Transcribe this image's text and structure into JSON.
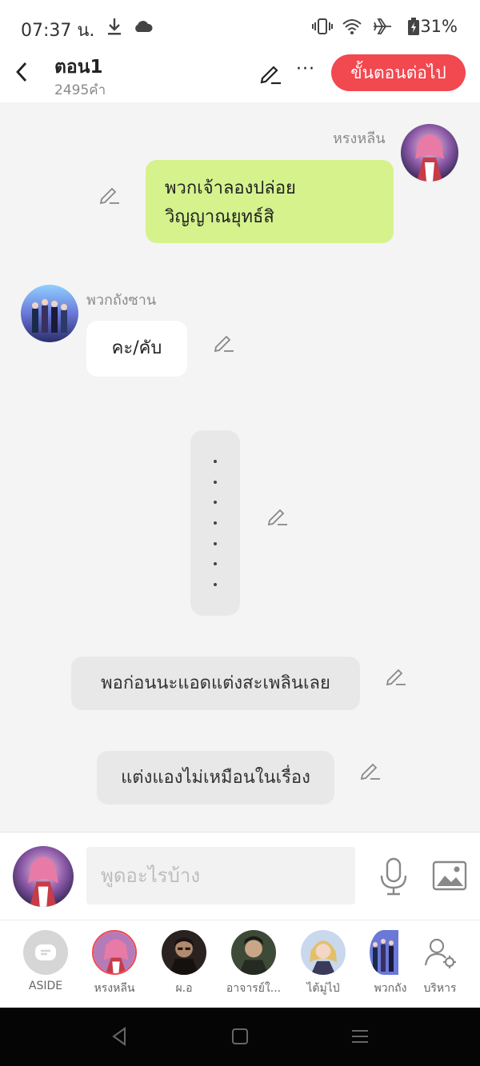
{
  "status_bar": {
    "time": "07:37 น.",
    "battery": "31%",
    "icons": [
      "download-icon",
      "cloud-icon",
      "vibrate-icon",
      "wifi-icon",
      "airplane-icon",
      "battery-icon"
    ]
  },
  "header": {
    "title": "ตอน1",
    "word_count": "2495คำ",
    "more_label": "···",
    "next_button": "ขั้นตอนต่อไป",
    "accent_color": "#f24850"
  },
  "messages": [
    {
      "speaker": "หรงหลีน",
      "text": "พวกเจ้าลองปล่อย\nวิญญาณยุทธ์สิ",
      "side": "right",
      "bubble": "green"
    },
    {
      "speaker": "พวกถังซาน",
      "text": "คะ/คับ",
      "side": "left",
      "bubble": "white"
    },
    {
      "speaker": "",
      "text": ".......",
      "side": "center",
      "bubble": "gray-vertical"
    },
    {
      "speaker": "",
      "text": "พอก่อนนะแอดแต่งสะเพลินเลย",
      "side": "center",
      "bubble": "gray"
    },
    {
      "speaker": "",
      "text": "แต่งแองไม่เหมือนในเรื่อง",
      "side": "center",
      "bubble": "gray"
    }
  ],
  "input": {
    "placeholder": "พูดอะไรบ้าง"
  },
  "characters": [
    {
      "label": "ASIDE"
    },
    {
      "label": "หรงหลีน"
    },
    {
      "label": "ผ.อ"
    },
    {
      "label": "อาจารย์ใ..."
    },
    {
      "label": "ไต้มู่ไป่"
    },
    {
      "label": "พวกถัง"
    },
    {
      "label": "บริหาร"
    }
  ],
  "colors": {
    "green_bubble": "#d5f28d",
    "chat_bg": "#f4f4f4"
  }
}
